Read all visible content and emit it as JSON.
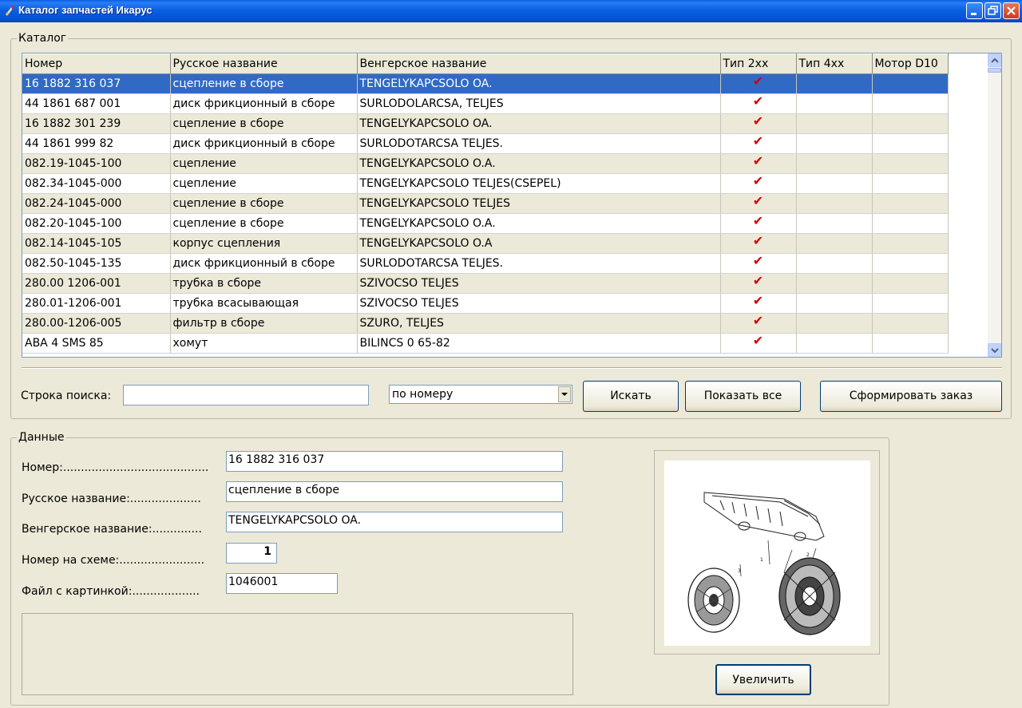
{
  "window": {
    "title": "Каталог запчастей Икарус"
  },
  "catalog": {
    "legend": "Каталог",
    "columns": [
      "Номер",
      "Русское название",
      "Венгерское название",
      "Тип 2хх",
      "Тип 4хх",
      "Мотор D10"
    ],
    "rows": [
      {
        "number": "16 1882 316 037",
        "ru": "сцепление в сборе",
        "hu": "TENGELYKAPCSOLO OA.",
        "t2": "✔",
        "t4": "",
        "d10": ""
      },
      {
        "number": "44 1861 687 001",
        "ru": "диск фрикционный в сборе",
        "hu": "SURLODOLARCSA, TELJES",
        "t2": "✔",
        "t4": "",
        "d10": ""
      },
      {
        "number": "16 1882 301 239",
        "ru": "сцепление в сборе",
        "hu": "TENGELYKAPCSOLO OA.",
        "t2": "✔",
        "t4": "",
        "d10": ""
      },
      {
        "number": "44 1861 999 82",
        "ru": "диск фрикционный в сборе",
        "hu": "SURLODOTARCSA TELJES.",
        "t2": "✔",
        "t4": "",
        "d10": ""
      },
      {
        "number": "082.19-1045-100",
        "ru": "сцепление",
        "hu": "TENGELYKAPCSOLO O.A.",
        "t2": "✔",
        "t4": "",
        "d10": ""
      },
      {
        "number": "082.34-1045-000",
        "ru": "сцепление",
        "hu": "TENGELYKAPCSOLO TELJES(CSEPEL)",
        "t2": "✔",
        "t4": "",
        "d10": ""
      },
      {
        "number": "082.24-1045-000",
        "ru": "сцепление в сборе",
        "hu": "TENGELYKAPCSOLO TELJES",
        "t2": "✔",
        "t4": "",
        "d10": ""
      },
      {
        "number": "082.20-1045-100",
        "ru": "сцепление в сборе",
        "hu": "TENGELYKAPCSOLO O.A.",
        "t2": "✔",
        "t4": "",
        "d10": ""
      },
      {
        "number": "082.14-1045-105",
        "ru": "корпус сцепления",
        "hu": "TENGELYKAPCSOLO O.A",
        "t2": "✔",
        "t4": "",
        "d10": ""
      },
      {
        "number": "082.50-1045-135",
        "ru": "диск фрикционный в сборе",
        "hu": "SURLODOTARCSA TELJES.",
        "t2": "✔",
        "t4": "",
        "d10": ""
      },
      {
        "number": "280.00 1206-001",
        "ru": "трубка в сборе",
        "hu": "SZIVOCSO TELJES",
        "t2": "✔",
        "t4": "",
        "d10": ""
      },
      {
        "number": "280.01-1206-001",
        "ru": "трубка всасывающая",
        "hu": "SZIVOCSO TELJES",
        "t2": "✔",
        "t4": "",
        "d10": ""
      },
      {
        "number": "280.00-1206-005",
        "ru": "фильтр в сборе",
        "hu": "SZURO, TELJES",
        "t2": "✔",
        "t4": "",
        "d10": ""
      },
      {
        "number": "ABA 4 SMS 85",
        "ru": "хомут",
        "hu": "BILINCS 0 65-82",
        "t2": "✔",
        "t4": "",
        "d10": ""
      }
    ],
    "selected_row_index": 0
  },
  "search": {
    "label": "Строка поиска:",
    "value": "",
    "mode_selected": "по номеру",
    "search_button": "Искать",
    "show_all_button": "Показать все",
    "order_button": "Сформировать заказ"
  },
  "details": {
    "legend": "Данные",
    "number_label": "Номер:",
    "number_value": "16 1882 316 037",
    "ru_label": "Русское название:",
    "ru_value": "сцепление в сборе",
    "hu_label": "Венгерское название:",
    "hu_value": "TENGELYKAPCSOLO OA.",
    "scheme_label": "Номер на схеме:",
    "scheme_value": "1",
    "file_label": "Файл с картинкой:",
    "file_value": "1046001",
    "notes_value": ""
  },
  "preview": {
    "zoom_button": "Увеличить"
  },
  "colors": {
    "selection": "#316ac5",
    "check": "#d40000",
    "window_bg": "#ece9d8"
  }
}
